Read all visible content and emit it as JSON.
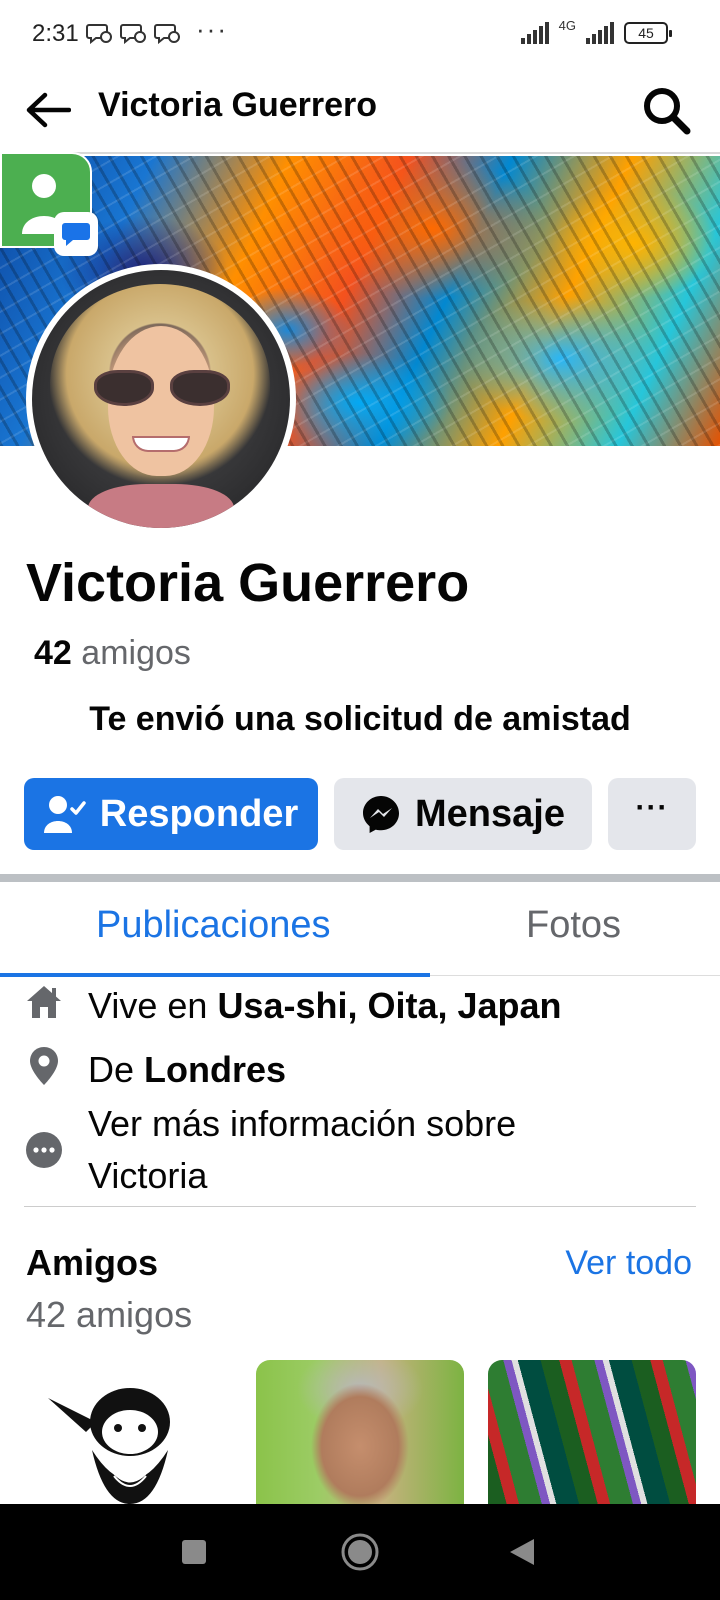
{
  "status_bar": {
    "time": "2:31",
    "more": "···",
    "network": "4G",
    "battery": "45"
  },
  "header": {
    "title": "Victoria Guerrero"
  },
  "profile": {
    "name": "Victoria Guerrero",
    "friends_count": "42",
    "friends_label": "amigos",
    "request_text": "Te envió una solicitud de amistad"
  },
  "actions": {
    "respond_label": "Responder",
    "message_label": "Mensaje",
    "more_label": "···"
  },
  "tabs": [
    {
      "label": "Publicaciones",
      "active": true
    },
    {
      "label": "Fotos",
      "active": false
    }
  ],
  "details": {
    "lives_prefix": "Vive en ",
    "lives_place": "Usa-shi, Oita, Japan",
    "from_prefix": "De ",
    "from_place": "Londres",
    "more_info": "Ver más información sobre Victoria"
  },
  "friends": {
    "title": "Amigos",
    "see_all": "Ver todo",
    "subtitle": "42 amigos"
  },
  "icons": {
    "back": "arrow-left-icon",
    "search": "search-icon",
    "home": "home-icon",
    "location": "location-pin-icon",
    "more_info": "more-dots-icon",
    "add_friend": "person-check-icon",
    "messenger": "messenger-icon"
  },
  "colors": {
    "accent": "#1b74e4",
    "secondary_button": "#e4e6eb",
    "muted_text": "#65676b"
  }
}
